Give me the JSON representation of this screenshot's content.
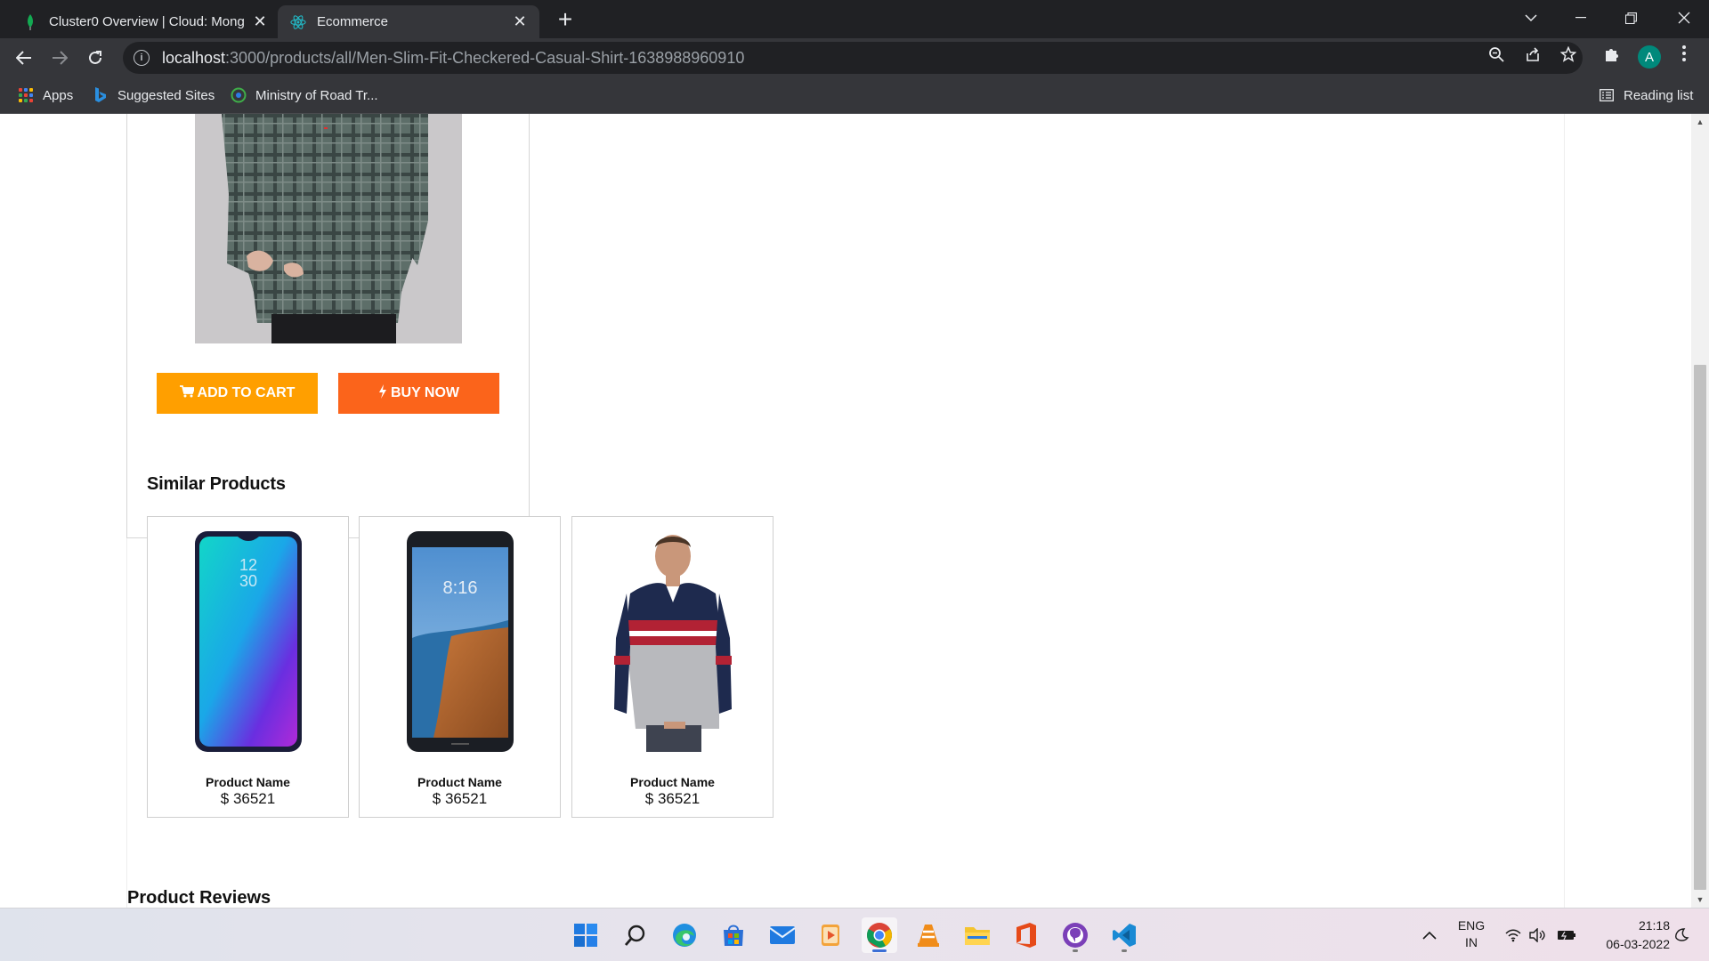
{
  "browser": {
    "tabs": [
      {
        "title": "Cluster0 Overview | Cloud: Mong",
        "active": false,
        "icon": "mongodb-leaf-icon"
      },
      {
        "title": "Ecommerce",
        "active": true,
        "icon": "react-icon"
      }
    ],
    "new_tab": "+",
    "url_host": "localhost",
    "url_path": ":3000/products/all/Men-Slim-Fit-Checkered-Casual-Shirt-1638988960910",
    "profile_initial": "A",
    "bookmarks": [
      {
        "label": "Apps",
        "icon": "apps-grid-icon"
      },
      {
        "label": "Suggested Sites",
        "icon": "bing-icon"
      },
      {
        "label": "Ministry of Road Tr...",
        "icon": "ministry-logo-icon"
      }
    ],
    "reading_list": "Reading list"
  },
  "product": {
    "add_to_cart": "ADD TO CART",
    "buy_now": "BUY NOW",
    "colors": {
      "cart": "#ff9f00",
      "buy": "#fb641b"
    }
  },
  "similar": {
    "title": "Similar Products",
    "items": [
      {
        "name": "Product Name",
        "price": "$ 36521",
        "image": "phone-gradient"
      },
      {
        "name": "Product Name",
        "price": "$ 36521",
        "image": "phone-landscape"
      },
      {
        "name": "Product Name",
        "price": "$ 36521",
        "image": "sweater-man"
      }
    ]
  },
  "reviews": {
    "title": "Product Reviews"
  },
  "taskbar": {
    "lang_top": "ENG",
    "lang_bottom": "IN",
    "time": "21:18",
    "date": "06-03-2022"
  }
}
